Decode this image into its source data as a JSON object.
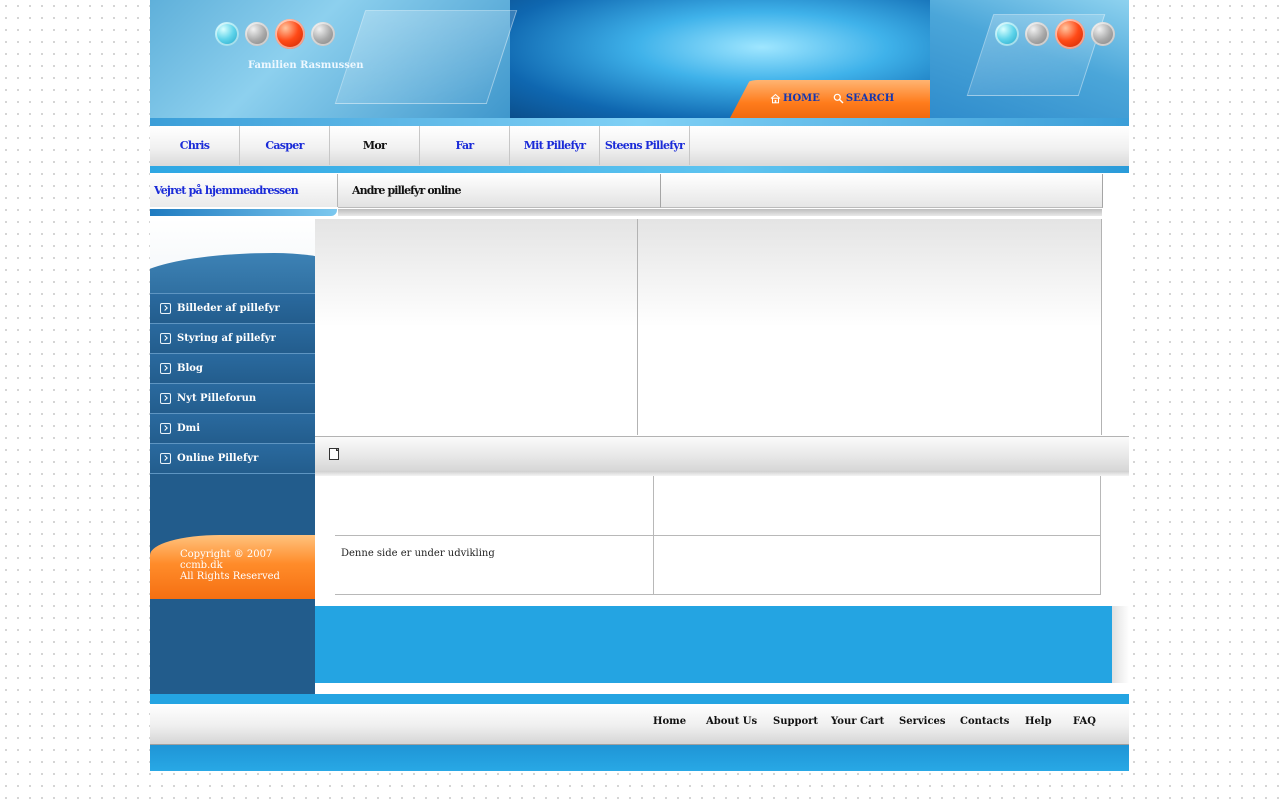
{
  "header": {
    "site_title": "Familien Rasmussen",
    "top_links": [
      {
        "label": "HOME",
        "icon": "home-icon"
      },
      {
        "label": "SEARCH",
        "icon": "search-icon"
      }
    ]
  },
  "nav": {
    "tabs": [
      {
        "label": "Chris",
        "color": "#1a2bd8"
      },
      {
        "label": "Casper",
        "color": "#1a2bd8"
      },
      {
        "label": "Mor",
        "color": "#111111"
      },
      {
        "label": "Far",
        "color": "#1a2bd8"
      },
      {
        "label": "Mit Pillefyr",
        "color": "#1a2bd8"
      },
      {
        "label": "Steens Pillefyr",
        "color": "#1a2bd8"
      }
    ]
  },
  "subbar": {
    "weather_title": "Vejret på  hjemmeadressen",
    "online_title": "Andre pillefyr online"
  },
  "sidebar": {
    "items": [
      {
        "label": "Billeder af pillefyr"
      },
      {
        "label": "Styring af pillefyr"
      },
      {
        "label": "Blog"
      },
      {
        "label": "Nyt Pilleforun"
      },
      {
        "label": "Dmi"
      },
      {
        "label": "Online Pillefyr"
      }
    ],
    "copyright": {
      "line1": "Copyright ® 2007",
      "line2": "ccmb.dk",
      "line3": "All Rights Reserved"
    }
  },
  "main": {
    "under_dev": "Denne side er under udvikling"
  },
  "footer": {
    "links": [
      "Home",
      "About Us",
      "Support",
      "Your Cart",
      "Services",
      "Contacts",
      "Help",
      "FAQ"
    ]
  },
  "colors": {
    "accent_blue": "#24a4e2",
    "sidebar_blue": "#225c8c",
    "orange": "#ff7c1c",
    "link_blue": "#1a2bd8"
  }
}
